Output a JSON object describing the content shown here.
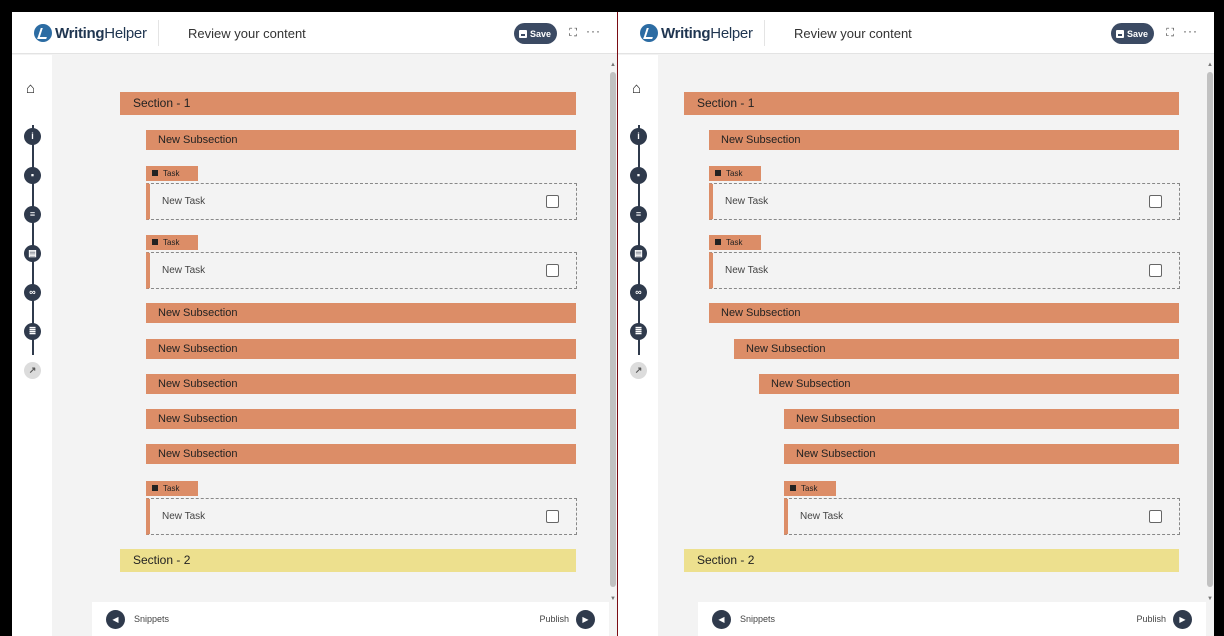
{
  "app": {
    "logo_strong": "Writing",
    "logo_light": "Helper"
  },
  "header": {
    "title": "Review your content",
    "save_label": "Save"
  },
  "rail": {
    "home_icon": "home-icon",
    "step_icons": [
      "info-icon",
      "comment-icon",
      "list-icon",
      "document-icon",
      "link-icon",
      "checklist-icon",
      "external-link-icon"
    ]
  },
  "outline": {
    "section1": "Section - 1",
    "section2": "Section - 2",
    "subsection_label": "New Subsection",
    "task_tab_label": "Task",
    "task_label": "New Task"
  },
  "footer": {
    "snippets_label": "Snippets",
    "publish_label": "Publish"
  },
  "colors": {
    "section": "#dc8d67",
    "section2": "#ede08e",
    "accent": "#2f3a4c"
  }
}
